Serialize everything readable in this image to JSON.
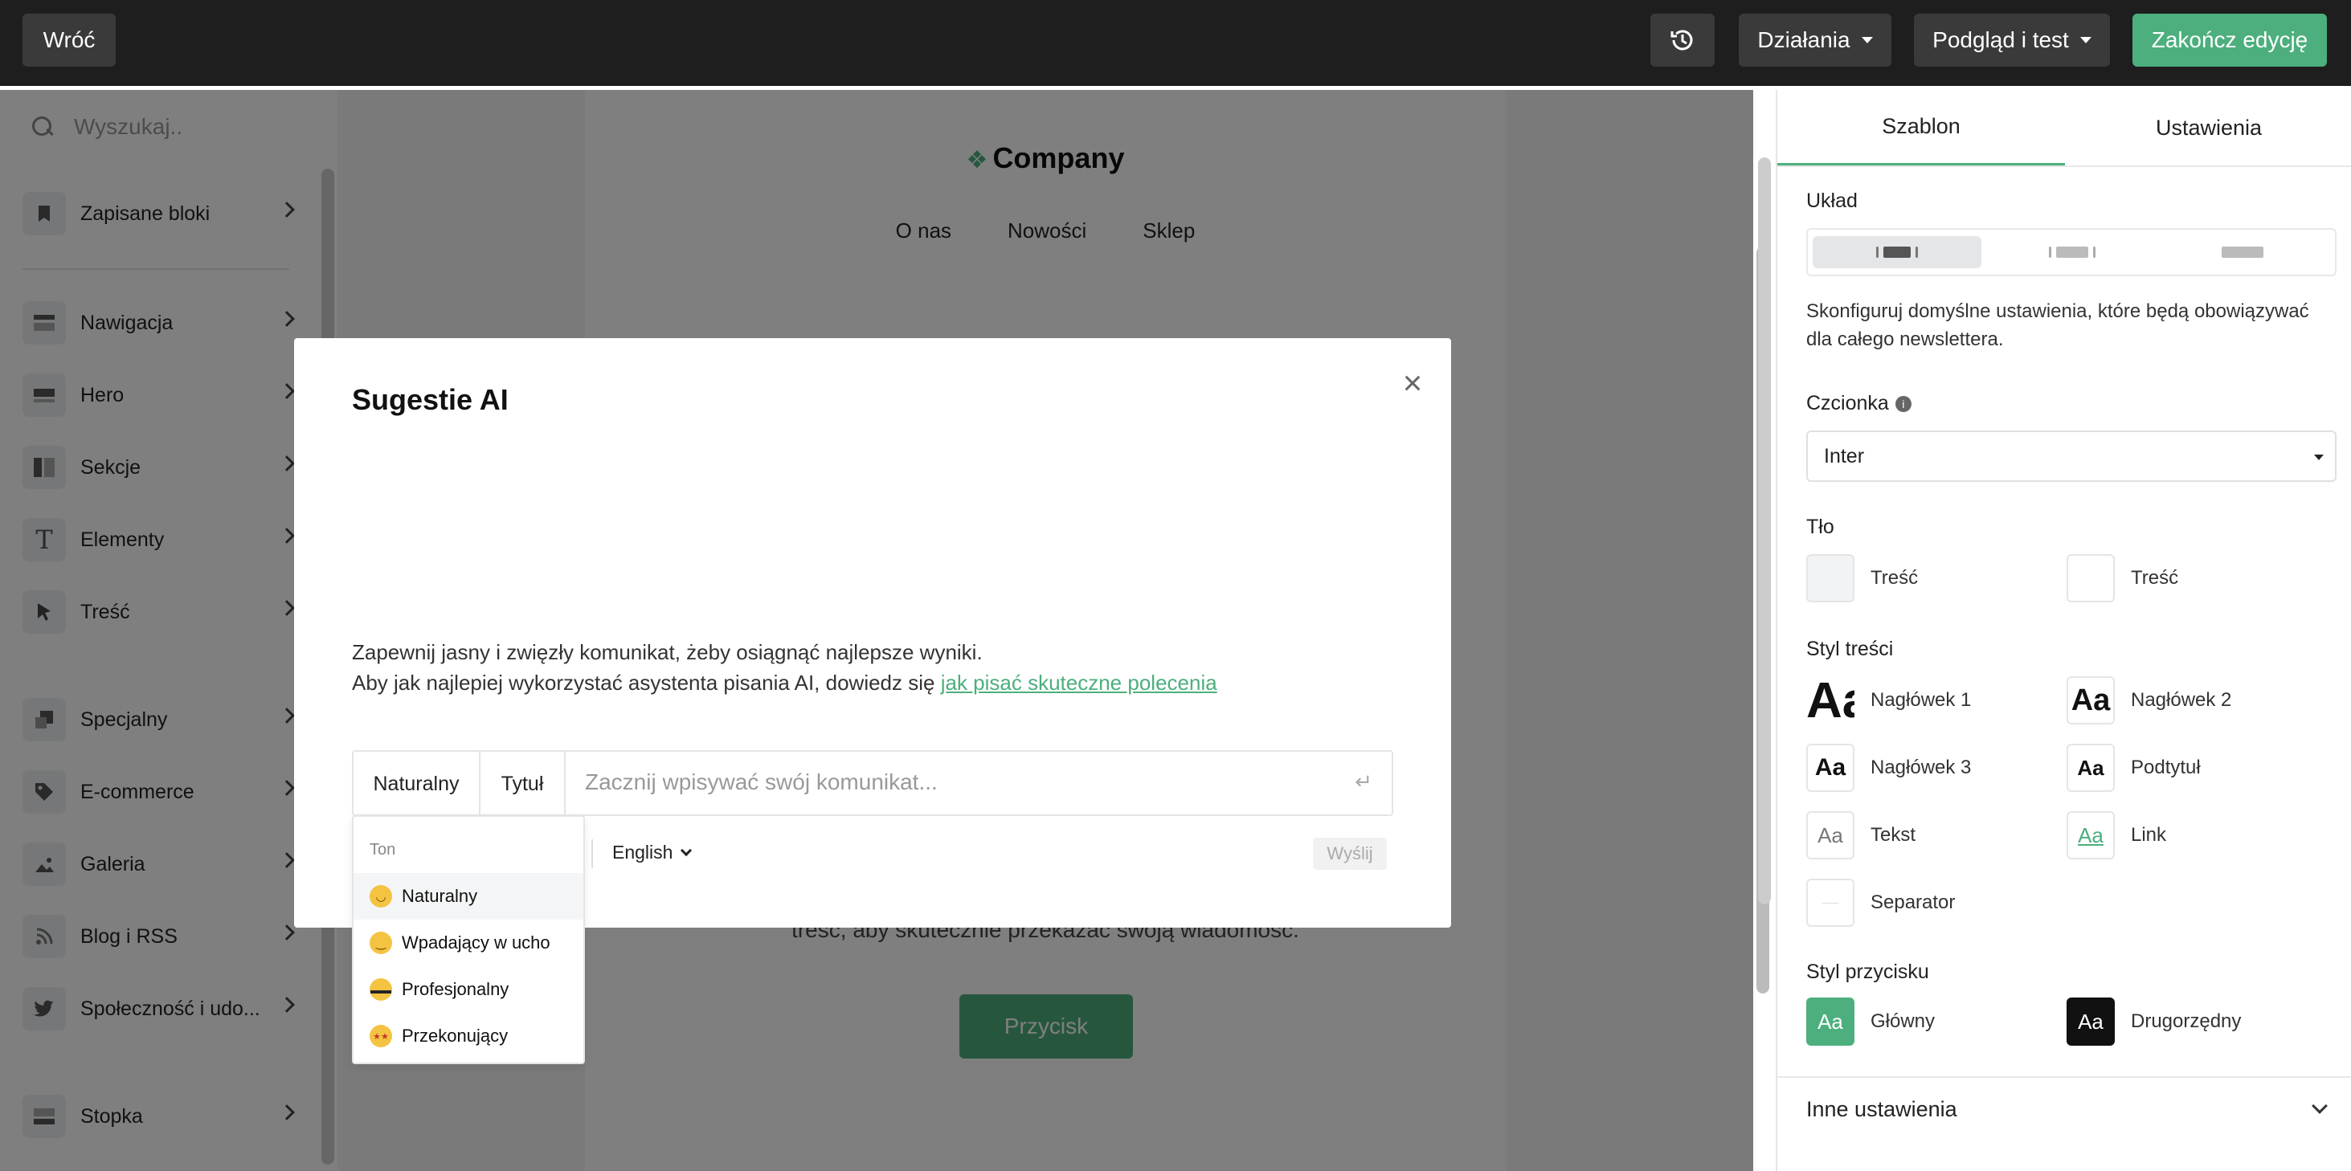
{
  "topbar": {
    "back_label": "Wróć",
    "actions_label": "Działania",
    "preview_label": "Podgląd i test",
    "finish_label": "Zakończ edycję",
    "history_icon": "history-icon",
    "colors": {
      "bar": "#1e1e1e",
      "button": "#3a3a3a",
      "accent": "#4caf7d"
    }
  },
  "sidebar": {
    "search_placeholder": "Wyszukaj..",
    "items": [
      {
        "label": "Zapisane bloki",
        "icon": "bookmark-icon"
      },
      {
        "label": "Nawigacja",
        "icon": "navigation-icon"
      },
      {
        "label": "Hero",
        "icon": "hero-icon"
      },
      {
        "label": "Sekcje",
        "icon": "sections-icon"
      },
      {
        "label": "Elementy",
        "icon": "text-icon"
      },
      {
        "label": "Treść",
        "icon": "cursor-icon"
      },
      {
        "label": "Specjalny",
        "icon": "special-icon"
      },
      {
        "label": "E-commerce",
        "icon": "tag-icon"
      },
      {
        "label": "Galeria",
        "icon": "image-icon"
      },
      {
        "label": "Blog i RSS",
        "icon": "rss-icon"
      },
      {
        "label": "Społeczność i udo...",
        "icon": "twitter-icon"
      },
      {
        "label": "Stopka",
        "icon": "footer-icon"
      }
    ]
  },
  "email": {
    "logo": "Company",
    "nav": [
      "O nas",
      "Nowości",
      "Sklep"
    ],
    "text": "treść, aby skutecznie przekazać swoją wiadomość.",
    "button": "Przycisk"
  },
  "modal": {
    "title": "Sugestie AI",
    "hint_line1": "Zapewnij jasny i zwięzły komunikat, żeby osiągnąć najlepsze wyniki.",
    "hint_line2": "Aby jak najlepiej wykorzystać asystenta pisania AI, dowiedz się ",
    "hint_link": "jak pisać skuteczne polecenia",
    "chip_tone": "Naturalny",
    "chip_type": "Tytuł",
    "prompt_placeholder": "Zacznij wpisywać swój komunikat...",
    "language": "English",
    "send_label": "Wyślij",
    "tone_menu": {
      "header": "Ton",
      "options": [
        "Naturalny",
        "Wpadający w ucho",
        "Profesjonalny",
        "Przekonujący"
      ],
      "emojis": [
        "🙂",
        "😏",
        "😎",
        "🤩"
      ]
    }
  },
  "right_panel": {
    "tabs": [
      "Szablon",
      "Ustawienia"
    ],
    "layout_label": "Układ",
    "description": "Skonfiguruj domyślne ustawienia, które będą obowiązywać dla całego newslettera.",
    "font_label": "Czcionka",
    "font_value": "Inter",
    "background_label": "Tło",
    "bg_items": [
      "Treść",
      "Treść"
    ],
    "content_style_label": "Styl treści",
    "styles": [
      {
        "sample": "Aa",
        "label": "Nagłówek 1"
      },
      {
        "sample": "Aa",
        "label": "Nagłówek 2"
      },
      {
        "sample": "Aa",
        "label": "Nagłówek 3"
      },
      {
        "sample": "Aa",
        "label": "Podtytuł"
      },
      {
        "sample": "Aa",
        "label": "Tekst"
      },
      {
        "sample": "Aa",
        "label": "Link"
      },
      {
        "sample": "",
        "label": "Separator"
      }
    ],
    "button_style_label": "Styl przycisku",
    "buttons": [
      {
        "sample": "Aa",
        "label": "Główny"
      },
      {
        "sample": "Aa",
        "label": "Drugorzędny"
      }
    ],
    "other_settings": "Inne ustawienia"
  }
}
